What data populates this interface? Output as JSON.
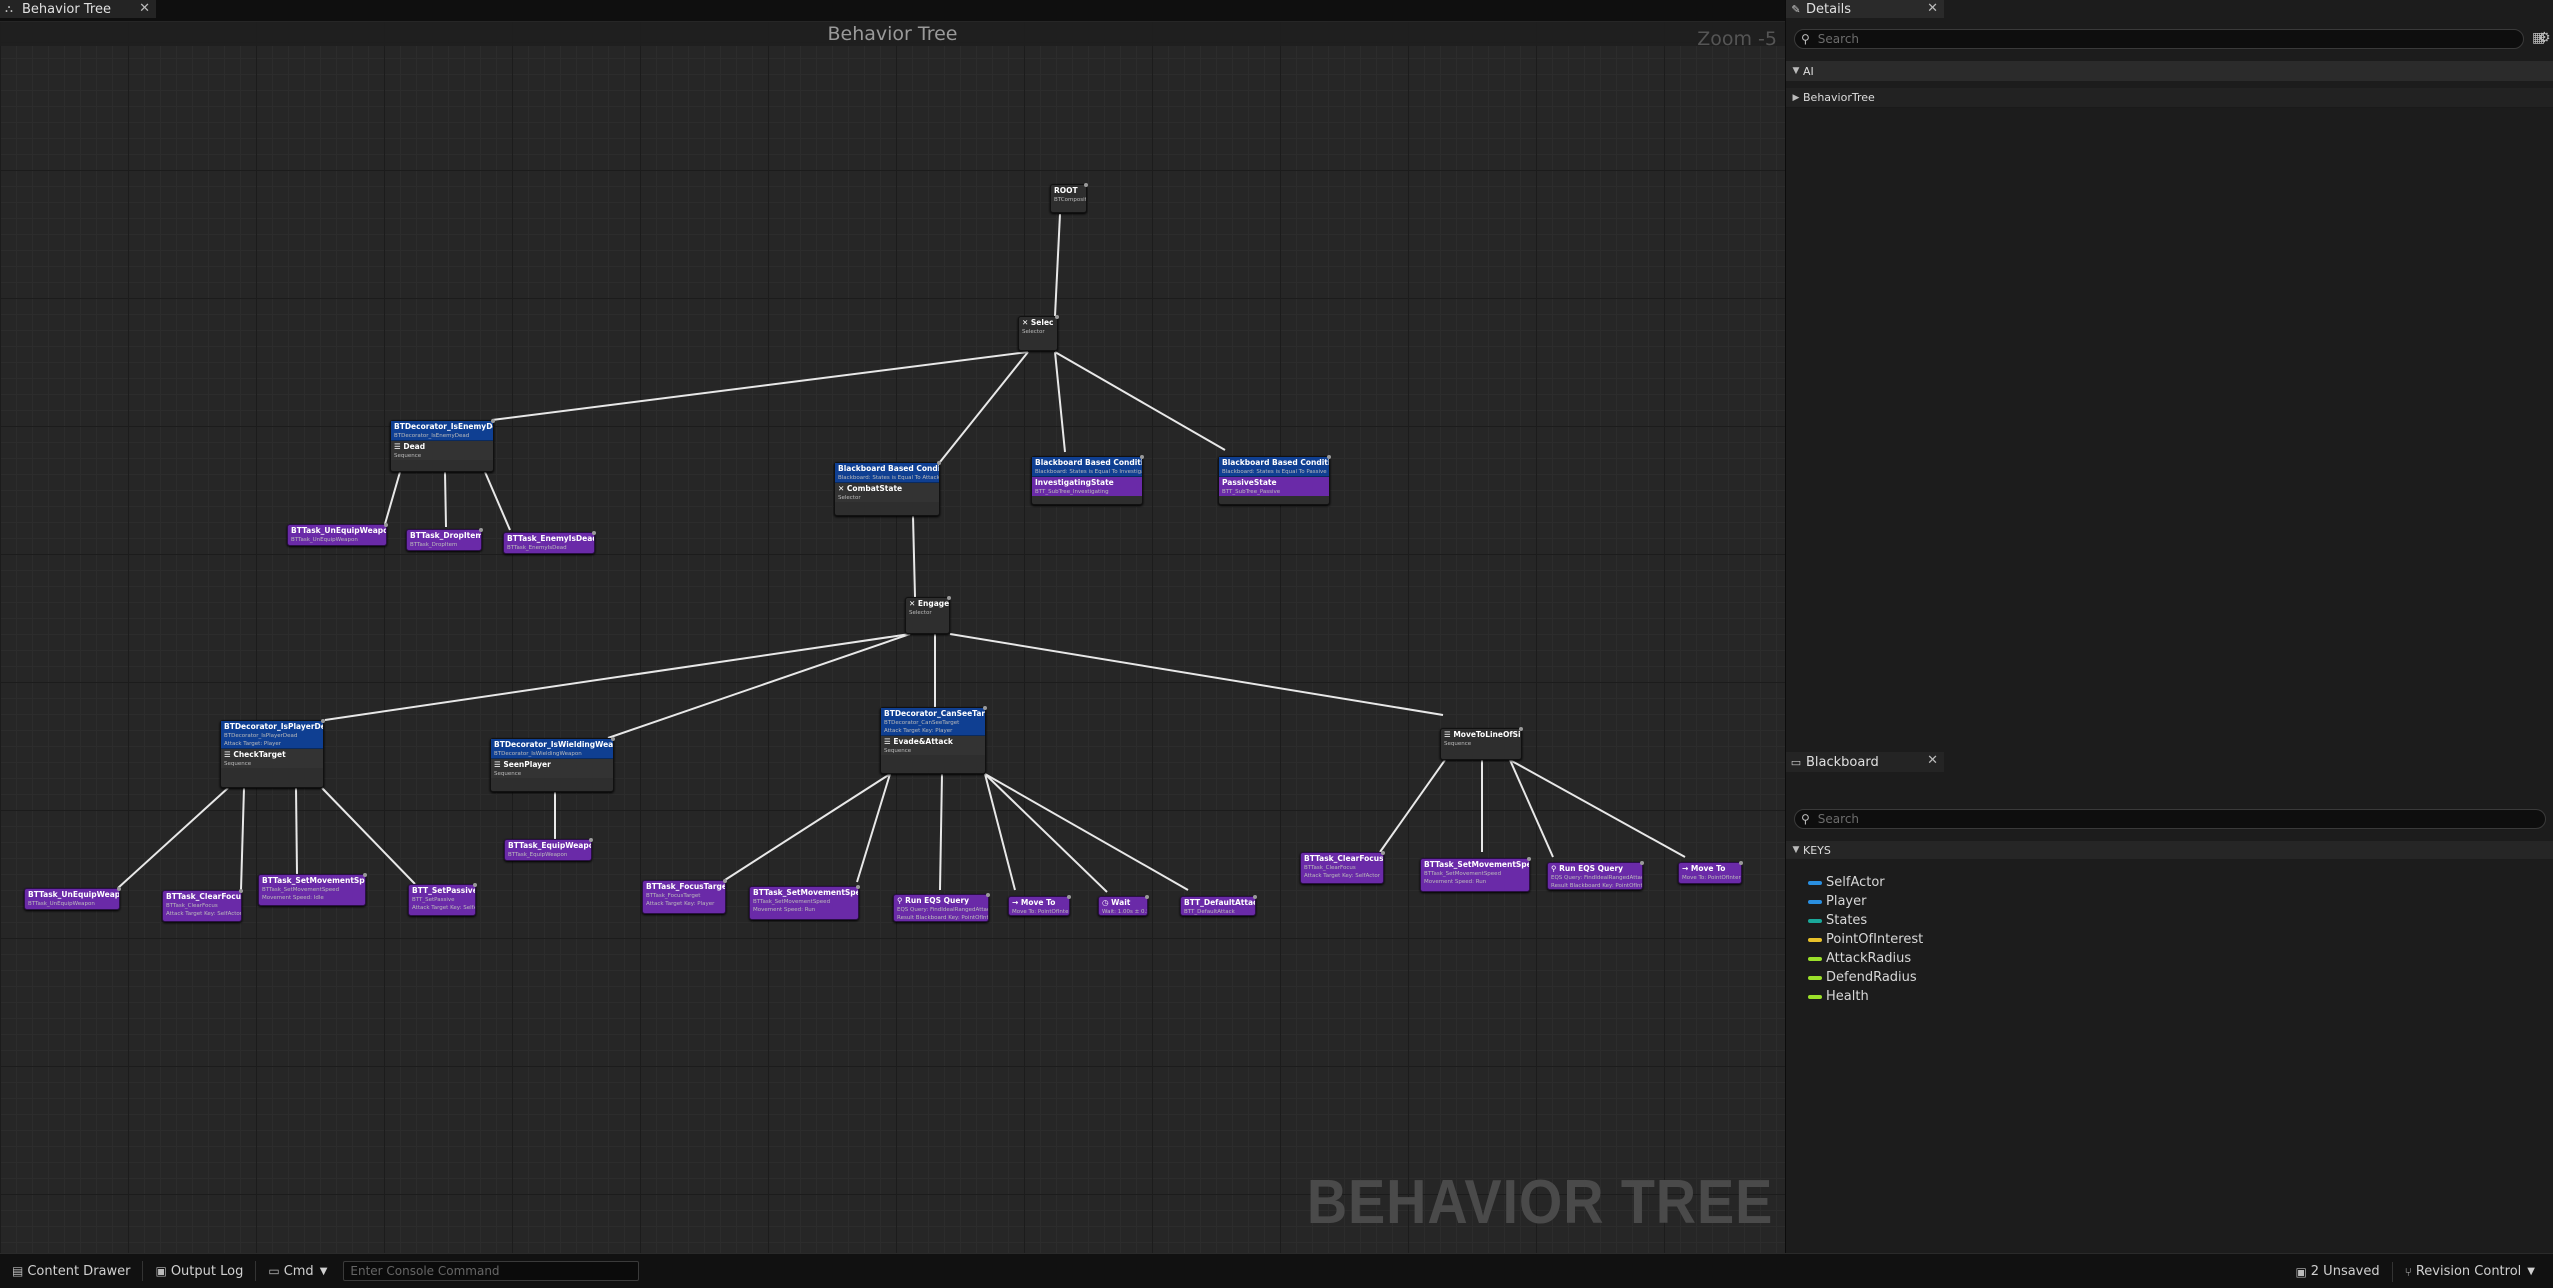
{
  "editor_tab": {
    "label": "Behavior Tree",
    "icon": "behavior-tree-icon"
  },
  "graph": {
    "title": "Behavior Tree",
    "zoom": "Zoom -5",
    "watermark": "BEHAVIOR TREE"
  },
  "nodes": {
    "root": {
      "title": "ROOT",
      "sub": "BTCompositeNode"
    },
    "selector": {
      "title": "Selec",
      "sub": "Selector"
    },
    "enemy_dead": {
      "dec": "BTDecorator_IsEnemyDead",
      "dec_sub": "BTDecorator_IsEnemyDead",
      "title": "Dead",
      "sub": "Sequence"
    },
    "unequip1": {
      "title": "BTTask_UnEquipWeapon",
      "sub": "BTTask_UnEquipWeapon"
    },
    "dropitem": {
      "title": "BTTask_DropItem",
      "sub": "BTTask_DropItem"
    },
    "enemyisdead": {
      "title": "BTTask_EnemyIsDead",
      "sub": "BTTask_EnemyIsDead"
    },
    "bb_combat": {
      "dec": "Blackboard Based Condition",
      "dec_sub": "Blackboard: States is Equal To Attacking",
      "title": "CombatState",
      "sub": "Selector"
    },
    "bb_investigating": {
      "dec": "Blackboard Based Condition",
      "dec_sub": "Blackboard: States is Equal To Investigating",
      "title": "InvestigatingState",
      "sub": "BTT_SubTree_Investigating"
    },
    "bb_passive": {
      "dec": "Blackboard Based Condition",
      "dec_sub": "Blackboard: States is Equal To Passive",
      "title": "PassiveState",
      "sub": "BTT_SubTree_Passive"
    },
    "engaged": {
      "title": "Engaged",
      "sub": "Selector"
    },
    "player_dead": {
      "dec": "BTDecorator_IsPlayerDead",
      "dec_sub": "BTDecorator_IsPlayerDead",
      "dec_sub2": "Attack Target: Player",
      "title": "CheckTarget",
      "sub": "Sequence"
    },
    "wielding": {
      "dec": "BTDecorator_IsWieldingWeapon",
      "dec_sub": "BTDecorator_IsWieldingWeapon",
      "title": "SeenPlayer",
      "sub": "Sequence"
    },
    "cansee": {
      "dec": "BTDecorator_CanSeeTarget",
      "dec_sub": "BTDecorator_CanSeeTarget",
      "dec_sub2": "Attack Target Key: Player",
      "title": "Evade&Attack",
      "sub": "Sequence"
    },
    "moveto_los": {
      "title": "MoveToLineOfSight",
      "sub": "Sequence"
    },
    "t_unequip2": {
      "title": "BTTask_UnEquipWeapon",
      "sub": "BTTask_UnEquipWeapon"
    },
    "t_clearfocus1": {
      "title": "BTTask_ClearFocus",
      "sub": "BTTask_ClearFocus",
      "sub2": "Attack Target Key: SelfActor"
    },
    "t_setspeed1": {
      "title": "BTTask_SetMovementSpeed",
      "sub": "BTTask_SetMovementSpeed",
      "sub2": "Movement Speed: Idle"
    },
    "t_setpassive": {
      "title": "BTT_SetPassive",
      "sub": "BTT_SetPassive",
      "sub2": "Attack Target Key: SelfActor"
    },
    "t_equip": {
      "title": "BTTask_EquipWeapon",
      "sub": "BTTask_EquipWeapon"
    },
    "t_focus": {
      "title": "BTTask_FocusTarget",
      "sub": "BTTask_FocusTarget",
      "sub2": "Attack Target Key: Player"
    },
    "t_setspeed2": {
      "title": "BTTask_SetMovementSpeed",
      "sub": "BTTask_SetMovementSpeed",
      "sub2": "Movement Speed: Run"
    },
    "t_eqs1": {
      "title": "Run EQS Query",
      "sub": "EQS Query: FindIdealRangedAttack",
      "sub2": "Result Blackboard Key: PointOfInterest"
    },
    "t_moveto1": {
      "title": "Move To",
      "sub": "Move To: PointOfInterest"
    },
    "t_wait": {
      "title": "Wait",
      "sub": "Wait: 1.00s ± 0.50s"
    },
    "t_defaultattack": {
      "title": "BTT_DefaultAttack",
      "sub": "BTT_DefaultAttack"
    },
    "t_clearfocus2": {
      "title": "BTTask_ClearFocus",
      "sub": "BTTask_ClearFocus",
      "sub2": "Attack Target Key: SelfActor"
    },
    "t_setspeed3": {
      "title": "BTTask_SetMovementSpeed",
      "sub": "BTTask_SetMovementSpeed",
      "sub2": "Movement Speed: Run"
    },
    "t_eqs2": {
      "title": "Run EQS Query",
      "sub": "EQS Query: FindIdealRangedAttack",
      "sub2": "Result Blackboard Key: PointOfInterest"
    },
    "t_moveto2": {
      "title": "Move To",
      "sub": "Move To: PointOfInterest"
    }
  },
  "details": {
    "tab": "Details",
    "search_placeholder": "Search",
    "category": "AI",
    "row": "BehaviorTree"
  },
  "blackboard": {
    "tab": "Blackboard",
    "search_placeholder": "Search",
    "keys_header": "KEYS",
    "keys": [
      {
        "name": "SelfActor",
        "color": "#2a8fe0"
      },
      {
        "name": "Player",
        "color": "#2a8fe0"
      },
      {
        "name": "States",
        "color": "#1aa89a"
      },
      {
        "name": "PointOfInterest",
        "color": "#e8c12a"
      },
      {
        "name": "AttackRadius",
        "color": "#9be02a"
      },
      {
        "name": "DefendRadius",
        "color": "#9be02a"
      },
      {
        "name": "Health",
        "color": "#9be02a"
      }
    ]
  },
  "statusbar": {
    "content_drawer": "Content Drawer",
    "output_log": "Output Log",
    "cmd": "Cmd",
    "console_placeholder": "Enter Console Command",
    "unsaved": "2 Unsaved",
    "revision": "Revision Control"
  }
}
